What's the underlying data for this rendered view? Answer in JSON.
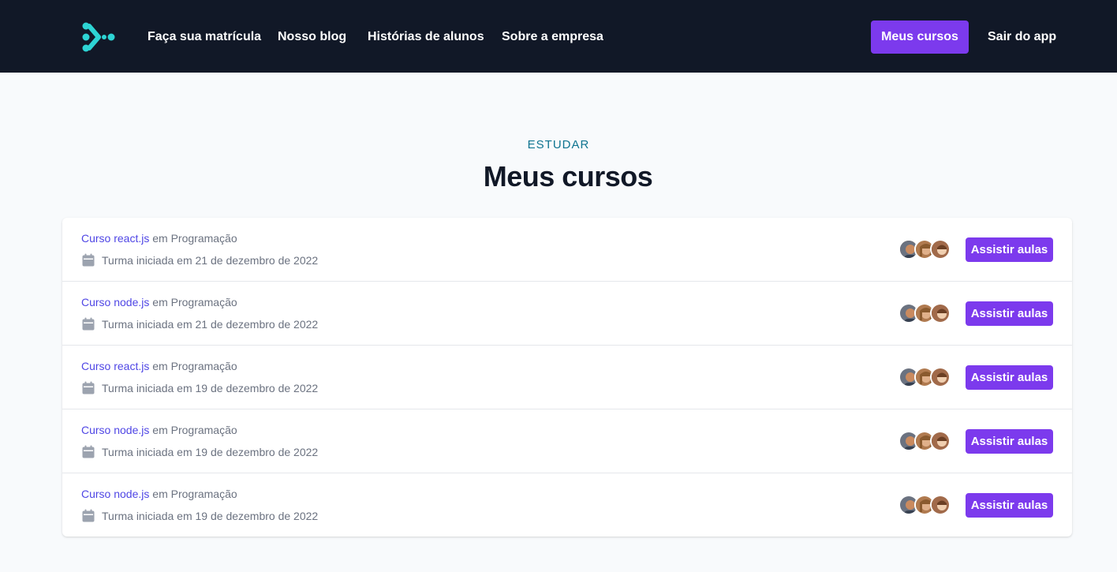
{
  "nav": {
    "logo_icon": "app-logo-icon",
    "links": [
      "Faça sua matrícula",
      "Nosso blog",
      "Histórias de alunos",
      "Sobre a empresa"
    ],
    "my_courses_label": "Meus cursos",
    "logout_label": "Sair do app"
  },
  "header": {
    "eyebrow": "ESTUDAR",
    "title": "Meus cursos"
  },
  "courses": [
    {
      "name": "Curso react.js",
      "category": "em Programação",
      "started": "Turma iniciada em 21 de dezembro de 2022",
      "action": "Assistir aulas"
    },
    {
      "name": "Curso node.js",
      "category": "em Programação",
      "started": "Turma iniciada em 21 de dezembro de 2022",
      "action": "Assistir aulas"
    },
    {
      "name": "Curso react.js",
      "category": "em Programação",
      "started": "Turma iniciada em 19 de dezembro de 2022",
      "action": "Assistir aulas"
    },
    {
      "name": "Curso node.js",
      "category": "em Programação",
      "started": "Turma iniciada em 19 de dezembro de 2022",
      "action": "Assistir aulas"
    },
    {
      "name": "Curso node.js",
      "category": "em Programação",
      "started": "Turma iniciada em 19 de dezembro de 2022",
      "action": "Assistir aulas"
    }
  ],
  "colors": {
    "navbar_bg": "#111827",
    "accent": "#7c3aed",
    "logo": "#2dd4d4",
    "eyebrow": "#0e7490",
    "course_link": "#4f46e5"
  }
}
